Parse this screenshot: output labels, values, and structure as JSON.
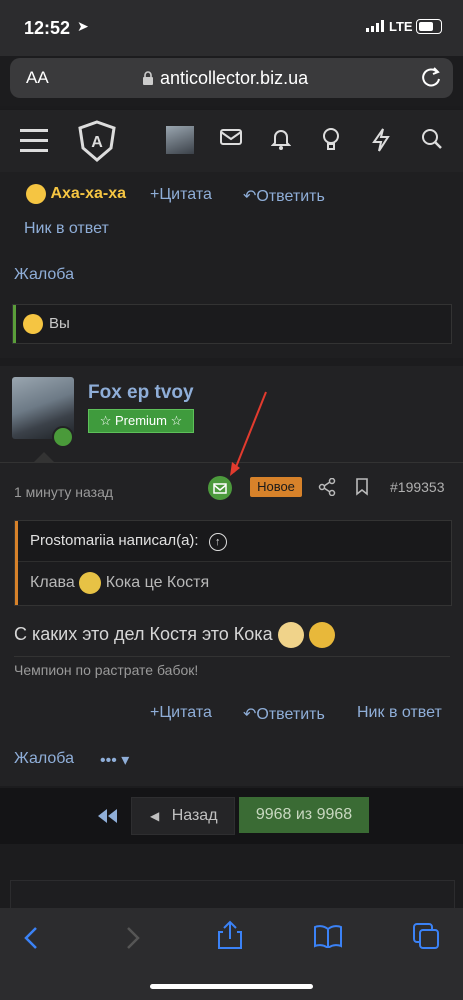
{
  "status_bar": {
    "time": "12:52",
    "network": "LTE"
  },
  "browser": {
    "text_size_button": "AA",
    "url": "anticollector.biz.ua"
  },
  "header": {
    "icons": [
      "menu-icon",
      "site-logo-icon",
      "avatar",
      "inbox-icon",
      "bell-icon",
      "lightbulb-icon",
      "lightning-icon",
      "search-icon"
    ]
  },
  "post1": {
    "reaction_label": "Аха-ха-ха",
    "quote_label": "+Цитата",
    "reply_label": "Ответить",
    "nick_reply": "Ник в ответ",
    "report": "Жалоба",
    "reactions_summary": "Вы"
  },
  "post2": {
    "username": "Fox ep tvoy",
    "badge": "☆ Premium ☆",
    "time_ago": "1 минуту назад",
    "new_badge": "Новое",
    "post_number": "#199353",
    "quote_author": "Prostomariia написал(а):",
    "quote_text_1": "Клава",
    "quote_text_2": "Кока це Костя",
    "message": "С каких это дел Костя это Кока",
    "signature": "Чемпион по растрате бабок!",
    "quote_label": "+Цитата",
    "reply_label": "Ответить",
    "nick_reply": "Ник в ответ",
    "report": "Жалоба",
    "more": "•••"
  },
  "pagination": {
    "prev": "Назад",
    "current": "9968 из 9968"
  },
  "colors": {
    "link": "#8faed8",
    "accent_green": "#3f9b3d",
    "new_badge": "#d7822a"
  }
}
